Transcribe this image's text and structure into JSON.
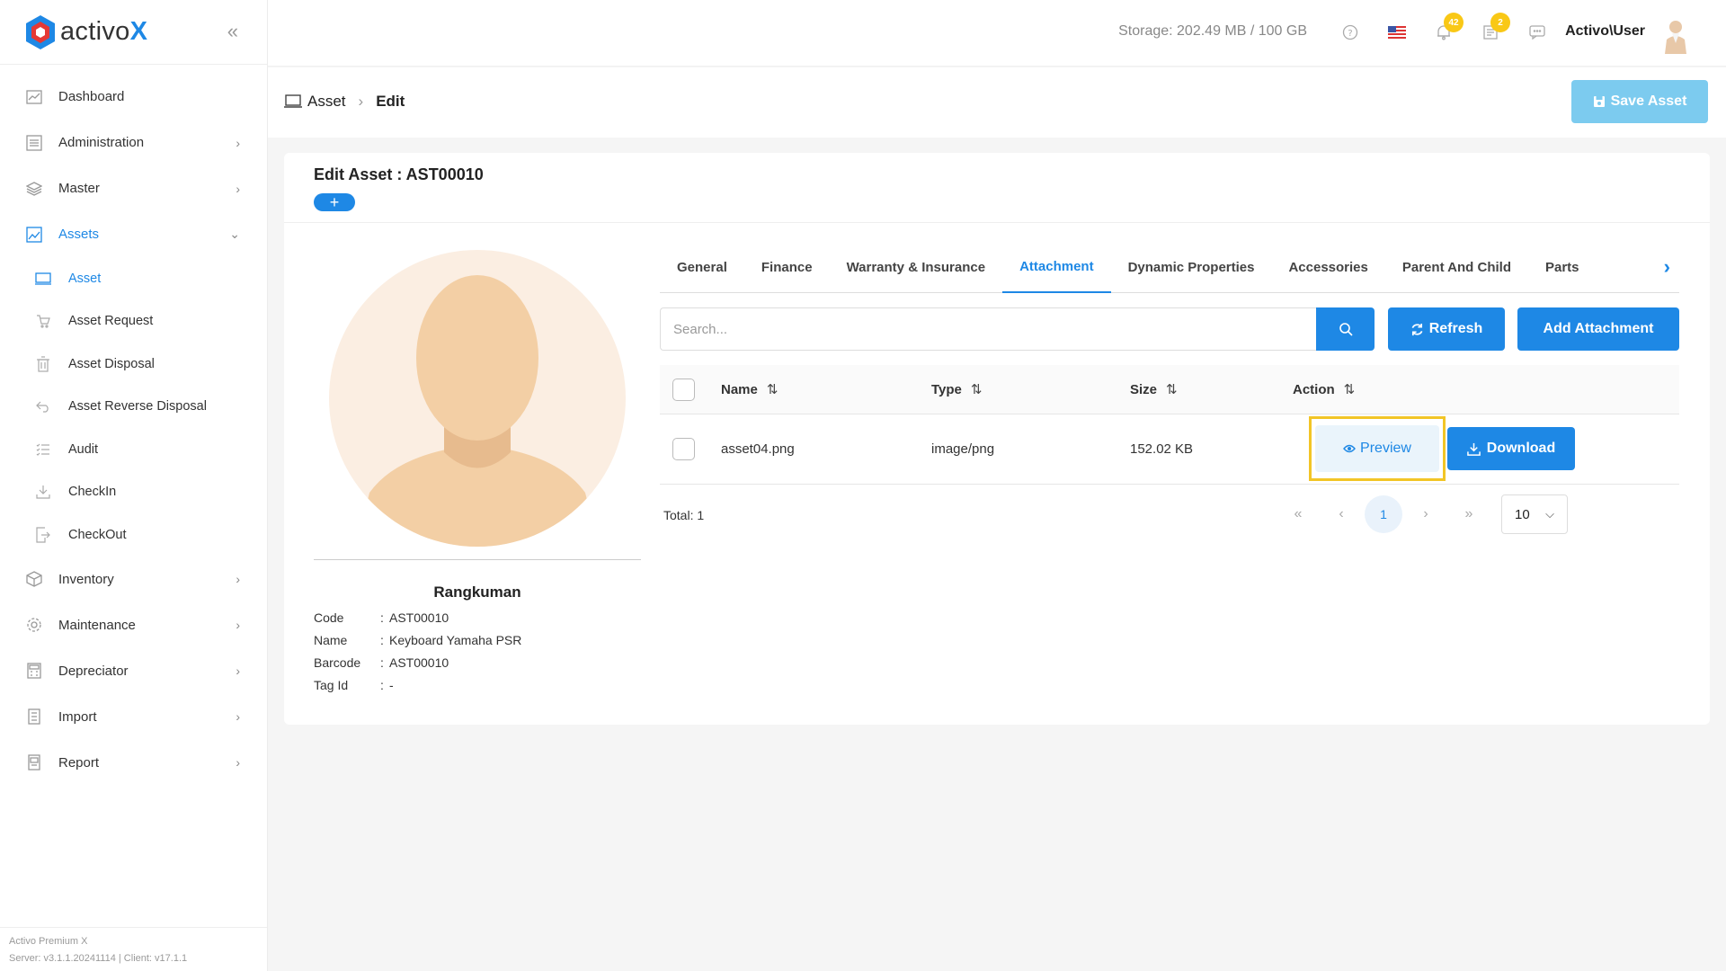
{
  "brand": {
    "name": "activo",
    "name_suffix": "X",
    "accent": "#1e88e5",
    "logo_red": "#e53935"
  },
  "sidebar": {
    "items": [
      {
        "label": "Dashboard",
        "icon": "chart-icon"
      },
      {
        "label": "Administration",
        "icon": "admin-icon"
      },
      {
        "label": "Master",
        "icon": "layers-icon"
      },
      {
        "label": "Assets",
        "icon": "assets-icon"
      },
      {
        "label": "Inventory",
        "icon": "box-icon"
      },
      {
        "label": "Maintenance",
        "icon": "gear-icon"
      },
      {
        "label": "Depreciator",
        "icon": "calculator-icon"
      },
      {
        "label": "Import",
        "icon": "import-icon"
      },
      {
        "label": "Report",
        "icon": "report-icon"
      }
    ],
    "sub_items": [
      {
        "label": "Asset"
      },
      {
        "label": "Asset Request"
      },
      {
        "label": "Asset Disposal"
      },
      {
        "label": "Asset Reverse Disposal"
      },
      {
        "label": "Audit"
      },
      {
        "label": "CheckIn"
      },
      {
        "label": "CheckOut"
      }
    ],
    "footer": {
      "product": "Activo Premium X",
      "version": "Server: v3.1.1.20241114 | Client: v17.1.1"
    }
  },
  "header": {
    "storage": "Storage: 202.49 MB / 100 GB",
    "notifications_count": "42",
    "tasks_count": "2",
    "user": "Activo\\User",
    "badge_color": "#f9c816"
  },
  "breadcrumb": {
    "root": "Asset",
    "current": "Edit"
  },
  "toolbar": {
    "save_label": "Save Asset",
    "plus_label": "+"
  },
  "card": {
    "title": "Edit Asset : AST00010"
  },
  "profile": {
    "name": "Rangkuman",
    "fields": [
      {
        "label": "Code",
        "value": "AST00010"
      },
      {
        "label": "Name",
        "value": "Keyboard Yamaha PSR"
      },
      {
        "label": "Barcode",
        "value": "AST00010"
      },
      {
        "label": "Tag Id",
        "value": "-"
      }
    ]
  },
  "tabs": [
    "General",
    "Finance",
    "Warranty & Insurance",
    "Attachment",
    "Dynamic Properties",
    "Accessories",
    "Parent And Child",
    "Parts"
  ],
  "active_tab": "Attachment",
  "search": {
    "placeholder": "Search...",
    "value": ""
  },
  "buttons": {
    "refresh": "Refresh",
    "add_attachment": "Add Attachment",
    "preview": "Preview",
    "download": "Download"
  },
  "table": {
    "columns": [
      "Name",
      "Type",
      "Size",
      "Action"
    ],
    "rows": [
      {
        "name": "asset04.png",
        "type": "image/png",
        "size": "152.02 KB"
      }
    ]
  },
  "pagination": {
    "total": "Total: 1",
    "current_page": "1",
    "page_size": "10"
  }
}
